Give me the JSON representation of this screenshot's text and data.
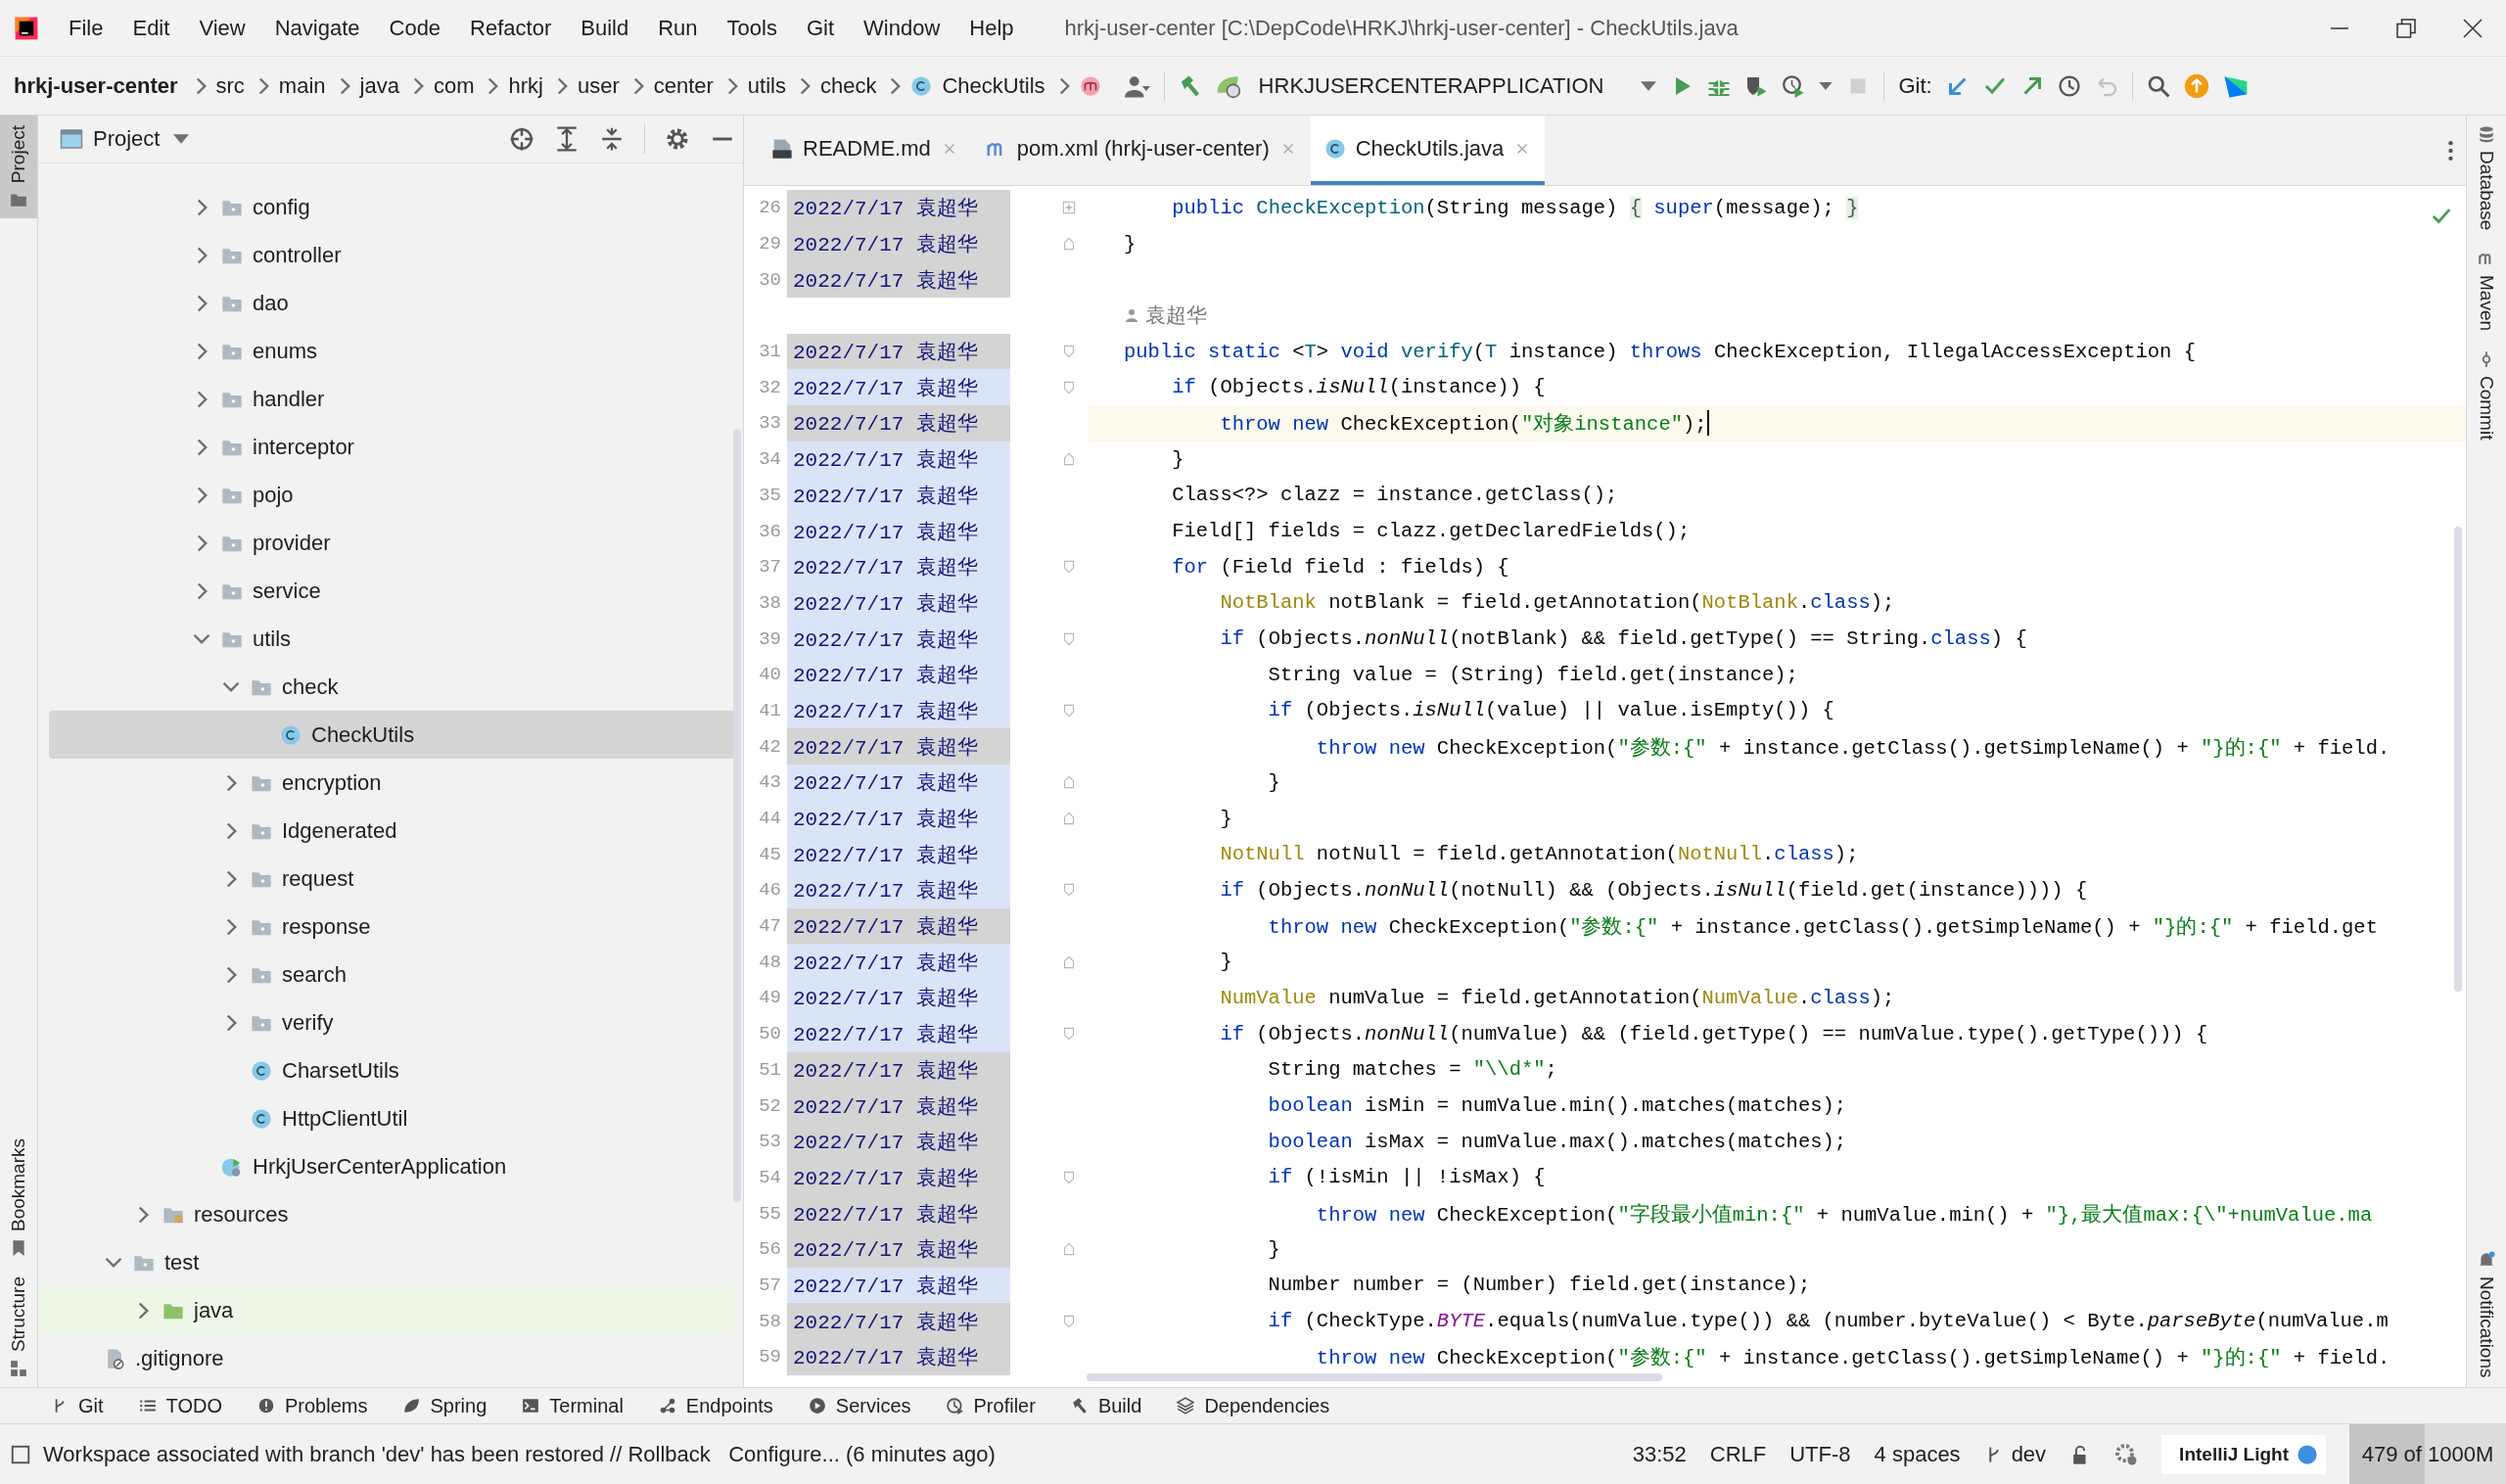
{
  "menu_bar": {
    "items": [
      {
        "label": "File"
      },
      {
        "label": "Edit"
      },
      {
        "label": "View"
      },
      {
        "label": "Navigate"
      },
      {
        "label": "Code"
      },
      {
        "label": "Refactor"
      },
      {
        "label": "Build"
      },
      {
        "label": "Run"
      },
      {
        "label": "Tools"
      },
      {
        "label": "Git"
      },
      {
        "label": "Window"
      },
      {
        "label": "Help"
      }
    ],
    "title": "hrkj-user-center [C:\\DepCode\\HRKJ\\hrkj-user-center] - CheckUtils.java"
  },
  "navigation_bar": {
    "project": "hrkj-user-center",
    "path": [
      "src",
      "main",
      "java",
      "com",
      "hrkj",
      "user",
      "center",
      "utils",
      "check"
    ],
    "file": "CheckUtils",
    "run_configuration": "HRKJUSERCENTERAPPLICATION",
    "git_label": "Git:"
  },
  "left_stripe": [
    {
      "label": "Project",
      "kind": "project",
      "selected": true
    },
    {
      "label": "Bookmarks",
      "kind": "bookmarks",
      "selected": false
    },
    {
      "label": "Structure",
      "kind": "structure",
      "selected": false
    }
  ],
  "project_panel": {
    "title": "Project",
    "tree": [
      {
        "children": [
          {
            "children": [
              {
                "children": [
                  {
                    "children": [
                      {
                        "label": "config",
                        "kind": "folder",
                        "expanded": false,
                        "selected": false
                      },
                      {
                        "label": "controller",
                        "kind": "folder",
                        "expanded": false,
                        "selected": false
                      },
                      {
                        "label": "dao",
                        "kind": "folder",
                        "expanded": false,
                        "selected": false
                      },
                      {
                        "label": "enums",
                        "kind": "folder",
                        "expanded": false,
                        "selected": false
                      },
                      {
                        "label": "handler",
                        "kind": "folder",
                        "expanded": false,
                        "selected": false
                      },
                      {
                        "label": "interceptor",
                        "kind": "folder",
                        "expanded": false,
                        "selected": false
                      },
                      {
                        "label": "pojo",
                        "kind": "folder",
                        "expanded": false,
                        "selected": false
                      },
                      {
                        "label": "provider",
                        "kind": "folder",
                        "expanded": false,
                        "selected": false
                      },
                      {
                        "label": "service",
                        "kind": "folder",
                        "expanded": false,
                        "selected": false
                      },
                      {
                        "label": "utils",
                        "kind": "folder",
                        "expanded": true,
                        "selected": false,
                        "children": [
                          {
                            "label": "check",
                            "kind": "folder",
                            "expanded": true,
                            "selected": false,
                            "children": [
                              {
                                "label": "CheckUtils",
                                "kind": "class",
                                "selected": true
                              }
                            ]
                          },
                          {
                            "label": "encryption",
                            "kind": "folder",
                            "expanded": false,
                            "selected": false
                          },
                          {
                            "label": "Idgenerated",
                            "kind": "folder",
                            "expanded": false,
                            "selected": false
                          },
                          {
                            "label": "request",
                            "kind": "folder",
                            "expanded": false,
                            "selected": false
                          },
                          {
                            "label": "response",
                            "kind": "folder",
                            "expanded": false,
                            "selected": false
                          },
                          {
                            "label": "search",
                            "kind": "folder",
                            "expanded": false,
                            "selected": false
                          },
                          {
                            "label": "verify",
                            "kind": "folder",
                            "expanded": false,
                            "selected": false
                          },
                          {
                            "label": "CharsetUtils",
                            "kind": "class",
                            "selected": false
                          },
                          {
                            "label": "HttpClientUtil",
                            "kind": "class",
                            "selected": false
                          }
                        ]
                      },
                      {
                        "label": "HrkjUserCenterApplication",
                        "kind": "application",
                        "selected": false
                      }
                    ]
                  }
                ]
              },
              {
                "label": "resources",
                "kind": "resources-folder",
                "expanded": false,
                "selected": false
              }
            ]
          },
          {
            "label": "test",
            "kind": "folder",
            "expanded": true,
            "selected": false,
            "children": [
              {
                "label": "java",
                "kind": "test-folder",
                "expanded": false,
                "selected": false
              }
            ]
          }
        ]
      },
      {
        "label": ".gitignore",
        "kind": "ignore-file",
        "selected": false
      }
    ]
  },
  "editor_tabs": [
    {
      "label": "README.md",
      "kind": "markdown",
      "selected": false
    },
    {
      "label": "pom.xml (hrkj-user-center)",
      "kind": "maven",
      "selected": false
    },
    {
      "label": "CheckUtils.java",
      "kind": "class",
      "selected": true
    }
  ],
  "editor": {
    "lines": [
      {
        "kind": "code",
        "number": "26",
        "date": "2022/7/17",
        "author": "袁超华",
        "color": "#d4d4d4",
        "current": false,
        "fold_marker": {
          "kind": "collapsed"
        },
        "tokens": [
          {
            "kind": "keyword",
            "text": "    public "
          },
          {
            "kind": "declaration",
            "text": "CheckException"
          },
          {
            "kind": "plain",
            "text": "(String message) "
          },
          {
            "kind": "folded",
            "text": "{"
          },
          {
            "kind": "keyword",
            "text": " super"
          },
          {
            "kind": "plain",
            "text": "(message); "
          },
          {
            "kind": "folded",
            "text": "}"
          }
        ]
      },
      {
        "kind": "code",
        "number": "29",
        "date": "2022/7/17",
        "author": "袁超华",
        "color": "#d4d4d4",
        "current": false,
        "fold_marker": {
          "kind": "end"
        },
        "tokens": [
          {
            "kind": "plain",
            "text": "}"
          }
        ]
      },
      {
        "kind": "code",
        "number": "30",
        "date": "2022/7/17",
        "author": "袁超华",
        "color": "#d4d4d4",
        "current": false
      },
      {
        "kind": "author-hint",
        "text": "袁超华"
      },
      {
        "kind": "code",
        "number": "31",
        "date": "2022/7/17",
        "author": "袁超华",
        "color": "#d4d4d4",
        "current": false,
        "fold_marker": {
          "kind": "start"
        },
        "tokens": [
          {
            "kind": "keyword",
            "text": "public static "
          },
          {
            "kind": "plain",
            "text": "<"
          },
          {
            "kind": "declaration",
            "text": "T"
          },
          {
            "kind": "plain",
            "text": "> "
          },
          {
            "kind": "keyword",
            "text": "void "
          },
          {
            "kind": "declaration",
            "text": "verify"
          },
          {
            "kind": "plain",
            "text": "("
          },
          {
            "kind": "declaration",
            "text": "T"
          },
          {
            "kind": "plain",
            "text": " instance) "
          },
          {
            "kind": "keyword",
            "text": "throws "
          },
          {
            "kind": "plain",
            "text": "CheckException, IllegalAccessException {"
          }
        ]
      },
      {
        "kind": "code",
        "number": "32",
        "date": "2022/7/17",
        "author": "袁超华",
        "color": "#dbe4f6",
        "current": false,
        "fold_marker": {
          "kind": "start"
        },
        "tokens": [
          {
            "kind": "keyword",
            "text": "    if "
          },
          {
            "kind": "plain",
            "text": "(Objects."
          },
          {
            "kind": "static-call",
            "text": "isNull"
          },
          {
            "kind": "plain",
            "text": "(instance)) {"
          }
        ]
      },
      {
        "kind": "code",
        "number": "33",
        "date": "2022/7/17",
        "author": "袁超华",
        "color": "#d4d4d4",
        "current": true,
        "tokens": [
          {
            "kind": "keyword",
            "text": "        throw new "
          },
          {
            "kind": "plain",
            "text": "CheckException("
          },
          {
            "kind": "string",
            "text": "\"对象instance\""
          },
          {
            "kind": "plain",
            "text": ");"
          }
        ]
      },
      {
        "kind": "code",
        "number": "34",
        "date": "2022/7/17",
        "author": "袁超华",
        "color": "#dbe4f6",
        "current": false,
        "fold_marker": {
          "kind": "end"
        },
        "tokens": [
          {
            "kind": "plain",
            "text": "    }"
          }
        ]
      },
      {
        "kind": "code",
        "number": "35",
        "date": "2022/7/17",
        "author": "袁超华",
        "color": "#dbe4f6",
        "current": false,
        "tokens": [
          {
            "kind": "plain",
            "text": "    Class<?> clazz = instance.getClass();"
          }
        ]
      },
      {
        "kind": "code",
        "number": "36",
        "date": "2022/7/17",
        "author": "袁超华",
        "color": "#dbe4f6",
        "current": false,
        "tokens": [
          {
            "kind": "plain",
            "text": "    Field[] fields = clazz.getDeclaredFields();"
          }
        ]
      },
      {
        "kind": "code",
        "number": "37",
        "date": "2022/7/17",
        "author": "袁超华",
        "color": "#dbe4f6",
        "current": false,
        "fold_marker": {
          "kind": "start"
        },
        "tokens": [
          {
            "kind": "keyword",
            "text": "    for "
          },
          {
            "kind": "plain",
            "text": "(Field field : fields) {"
          }
        ]
      },
      {
        "kind": "code",
        "number": "38",
        "date": "2022/7/17",
        "author": "袁超华",
        "color": "#dbe4f6",
        "current": false,
        "tokens": [
          {
            "kind": "annotation-type",
            "text": "        NotBlank"
          },
          {
            "kind": "plain",
            "text": " notBlank = field.getAnnotation("
          },
          {
            "kind": "annotation-type",
            "text": "NotBlank"
          },
          {
            "kind": "plain",
            "text": "."
          },
          {
            "kind": "keyword",
            "text": "class"
          },
          {
            "kind": "plain",
            "text": ");"
          }
        ]
      },
      {
        "kind": "code",
        "number": "39",
        "date": "2022/7/17",
        "author": "袁超华",
        "color": "#dbe4f6",
        "current": false,
        "fold_marker": {
          "kind": "start"
        },
        "tokens": [
          {
            "kind": "keyword",
            "text": "        if "
          },
          {
            "kind": "plain",
            "text": "(Objects."
          },
          {
            "kind": "static-call",
            "text": "nonNull"
          },
          {
            "kind": "plain",
            "text": "(notBlank) && field.getType() == String."
          },
          {
            "kind": "keyword",
            "text": "class"
          },
          {
            "kind": "plain",
            "text": ") {"
          }
        ]
      },
      {
        "kind": "code",
        "number": "40",
        "date": "2022/7/17",
        "author": "袁超华",
        "color": "#dbe4f6",
        "current": false,
        "tokens": [
          {
            "kind": "plain",
            "text": "            String value = (String) field.get(instance);"
          }
        ]
      },
      {
        "kind": "code",
        "number": "41",
        "date": "2022/7/17",
        "author": "袁超华",
        "color": "#dbe4f6",
        "current": false,
        "fold_marker": {
          "kind": "start"
        },
        "tokens": [
          {
            "kind": "keyword",
            "text": "            if "
          },
          {
            "kind": "plain",
            "text": "(Objects."
          },
          {
            "kind": "static-call",
            "text": "isNull"
          },
          {
            "kind": "plain",
            "text": "(value) || value.isEmpty()) {"
          }
        ]
      },
      {
        "kind": "code",
        "number": "42",
        "date": "2022/7/17",
        "author": "袁超华",
        "color": "#d4d4d4",
        "current": false,
        "tokens": [
          {
            "kind": "keyword",
            "text": "                throw new "
          },
          {
            "kind": "plain",
            "text": "CheckException("
          },
          {
            "kind": "string",
            "text": "\"参数:{\""
          },
          {
            "kind": "plain",
            "text": " + instance.getClass().getSimpleName() + "
          },
          {
            "kind": "string",
            "text": "\"}的:{\""
          },
          {
            "kind": "plain",
            "text": " + field."
          }
        ]
      },
      {
        "kind": "code",
        "number": "43",
        "date": "2022/7/17",
        "author": "袁超华",
        "color": "#dbe4f6",
        "current": false,
        "fold_marker": {
          "kind": "end"
        },
        "tokens": [
          {
            "kind": "plain",
            "text": "            }"
          }
        ]
      },
      {
        "kind": "code",
        "number": "44",
        "date": "2022/7/17",
        "author": "袁超华",
        "color": "#dbe4f6",
        "current": false,
        "fold_marker": {
          "kind": "end"
        },
        "tokens": [
          {
            "kind": "plain",
            "text": "        }"
          }
        ]
      },
      {
        "kind": "code",
        "number": "45",
        "date": "2022/7/17",
        "author": "袁超华",
        "color": "#dbe4f6",
        "current": false,
        "tokens": [
          {
            "kind": "annotation-type",
            "text": "        NotNull"
          },
          {
            "kind": "plain",
            "text": " notNull = field.getAnnotation("
          },
          {
            "kind": "annotation-type",
            "text": "NotNull"
          },
          {
            "kind": "plain",
            "text": "."
          },
          {
            "kind": "keyword",
            "text": "class"
          },
          {
            "kind": "plain",
            "text": ");"
          }
        ]
      },
      {
        "kind": "code",
        "number": "46",
        "date": "2022/7/17",
        "author": "袁超华",
        "color": "#dbe4f6",
        "current": false,
        "fold_marker": {
          "kind": "start"
        },
        "tokens": [
          {
            "kind": "keyword",
            "text": "        if "
          },
          {
            "kind": "plain",
            "text": "(Objects."
          },
          {
            "kind": "static-call",
            "text": "nonNull"
          },
          {
            "kind": "plain",
            "text": "(notNull) && (Objects."
          },
          {
            "kind": "static-call",
            "text": "isNull"
          },
          {
            "kind": "plain",
            "text": "(field.get(instance)))) {"
          }
        ]
      },
      {
        "kind": "code",
        "number": "47",
        "date": "2022/7/17",
        "author": "袁超华",
        "color": "#d4d4d4",
        "current": false,
        "tokens": [
          {
            "kind": "keyword",
            "text": "            throw new "
          },
          {
            "kind": "plain",
            "text": "CheckException("
          },
          {
            "kind": "string",
            "text": "\"参数:{\""
          },
          {
            "kind": "plain",
            "text": " + instance.getClass().getSimpleName() + "
          },
          {
            "kind": "string",
            "text": "\"}的:{\""
          },
          {
            "kind": "plain",
            "text": " + field.get"
          }
        ]
      },
      {
        "kind": "code",
        "number": "48",
        "date": "2022/7/17",
        "author": "袁超华",
        "color": "#dbe4f6",
        "current": false,
        "fold_marker": {
          "kind": "end"
        },
        "tokens": [
          {
            "kind": "plain",
            "text": "        }"
          }
        ]
      },
      {
        "kind": "code",
        "number": "49",
        "date": "2022/7/17",
        "author": "袁超华",
        "color": "#dbe4f6",
        "current": false,
        "tokens": [
          {
            "kind": "annotation-type",
            "text": "        NumValue"
          },
          {
            "kind": "plain",
            "text": " numValue = field.getAnnotation("
          },
          {
            "kind": "annotation-type",
            "text": "NumValue"
          },
          {
            "kind": "plain",
            "text": "."
          },
          {
            "kind": "keyword",
            "text": "class"
          },
          {
            "kind": "plain",
            "text": ");"
          }
        ]
      },
      {
        "kind": "code",
        "number": "50",
        "date": "2022/7/17",
        "author": "袁超华",
        "color": "#dbe4f6",
        "current": false,
        "fold_marker": {
          "kind": "start"
        },
        "tokens": [
          {
            "kind": "keyword",
            "text": "        if "
          },
          {
            "kind": "plain",
            "text": "(Objects."
          },
          {
            "kind": "static-call",
            "text": "nonNull"
          },
          {
            "kind": "plain",
            "text": "(numValue) && (field.getType() == numValue.type().getType())) {"
          }
        ]
      },
      {
        "kind": "code",
        "number": "51",
        "date": "2022/7/17",
        "author": "袁超华",
        "color": "#d4d4d4",
        "current": false,
        "tokens": [
          {
            "kind": "plain",
            "text": "            String matches = "
          },
          {
            "kind": "string",
            "text": "\"\\\\d*\""
          },
          {
            "kind": "plain",
            "text": ";"
          }
        ]
      },
      {
        "kind": "code",
        "number": "52",
        "date": "2022/7/17",
        "author": "袁超华",
        "color": "#d4d4d4",
        "current": false,
        "tokens": [
          {
            "kind": "keyword",
            "text": "            boolean "
          },
          {
            "kind": "plain",
            "text": "isMin = numValue.min().matches(matches);"
          }
        ]
      },
      {
        "kind": "code",
        "number": "53",
        "date": "2022/7/17",
        "author": "袁超华",
        "color": "#d4d4d4",
        "current": false,
        "tokens": [
          {
            "kind": "keyword",
            "text": "            boolean "
          },
          {
            "kind": "plain",
            "text": "isMax = numValue.max().matches(matches);"
          }
        ]
      },
      {
        "kind": "code",
        "number": "54",
        "date": "2022/7/17",
        "author": "袁超华",
        "color": "#d4d4d4",
        "current": false,
        "fold_marker": {
          "kind": "start"
        },
        "tokens": [
          {
            "kind": "keyword",
            "text": "            if "
          },
          {
            "kind": "plain",
            "text": "(!isMin || !isMax) {"
          }
        ]
      },
      {
        "kind": "code",
        "number": "55",
        "date": "2022/7/17",
        "author": "袁超华",
        "color": "#d4d4d4",
        "current": false,
        "tokens": [
          {
            "kind": "keyword",
            "text": "                throw new "
          },
          {
            "kind": "plain",
            "text": "CheckException("
          },
          {
            "kind": "string",
            "text": "\"字段最小值min:{\""
          },
          {
            "kind": "plain",
            "text": " + numValue.min() + "
          },
          {
            "kind": "string",
            "text": "\"},最大值max:{\\\"+numValue.ma"
          }
        ]
      },
      {
        "kind": "code",
        "number": "56",
        "date": "2022/7/17",
        "author": "袁超华",
        "color": "#d4d4d4",
        "current": false,
        "fold_marker": {
          "kind": "end"
        },
        "tokens": [
          {
            "kind": "plain",
            "text": "            }"
          }
        ]
      },
      {
        "kind": "code",
        "number": "57",
        "date": "2022/7/17",
        "author": "袁超华",
        "color": "#dbe4f6",
        "current": false,
        "tokens": [
          {
            "kind": "plain",
            "text": "            Number number = (Number) field.get(instance);"
          }
        ]
      },
      {
        "kind": "code",
        "number": "58",
        "date": "2022/7/17",
        "author": "袁超华",
        "color": "#d4d4d4",
        "current": false,
        "fold_marker": {
          "kind": "start"
        },
        "tokens": [
          {
            "kind": "keyword",
            "text": "            if "
          },
          {
            "kind": "plain",
            "text": "(CheckType."
          },
          {
            "kind": "constant",
            "text": "BYTE"
          },
          {
            "kind": "plain",
            "text": ".equals(numValue.type()) && (number.byteValue() < Byte."
          },
          {
            "kind": "static-call",
            "text": "parseByte"
          },
          {
            "kind": "plain",
            "text": "(numValue.m"
          }
        ]
      },
      {
        "kind": "code",
        "number": "59",
        "date": "2022/7/17",
        "author": "袁超华",
        "color": "#d4d4d4",
        "current": false,
        "tokens": [
          {
            "kind": "keyword",
            "text": "                throw new "
          },
          {
            "kind": "plain",
            "text": "CheckException("
          },
          {
            "kind": "string",
            "text": "\"参数:{\""
          },
          {
            "kind": "plain",
            "text": " + instance.getClass().getSimpleName() + "
          },
          {
            "kind": "string",
            "text": "\"}的:{\""
          },
          {
            "kind": "plain",
            "text": " + field."
          }
        ]
      }
    ]
  },
  "right_stripe": [
    {
      "label": "Database",
      "kind": "database"
    },
    {
      "label": "Maven",
      "kind": "maven"
    },
    {
      "label": "Commit",
      "kind": "commit"
    },
    {
      "label": "Notifications",
      "kind": "notifications"
    }
  ],
  "tool_tabs": [
    {
      "label": "Git",
      "kind": "git"
    },
    {
      "label": "TODO",
      "kind": "todo"
    },
    {
      "label": "Problems",
      "kind": "problems"
    },
    {
      "label": "Spring",
      "kind": "spring"
    },
    {
      "label": "Terminal",
      "kind": "terminal"
    },
    {
      "label": "Endpoints",
      "kind": "endpoints"
    },
    {
      "label": "Services",
      "kind": "services"
    },
    {
      "label": "Profiler",
      "kind": "profiler"
    },
    {
      "label": "Build",
      "kind": "build"
    },
    {
      "label": "Dependencies",
      "kind": "dependencies"
    }
  ],
  "status_bar": {
    "message": "Workspace associated with branch 'dev' has been restored // Rollback   Configure... (6 minutes ago)",
    "position": "33:52",
    "line_separator": "CRLF",
    "encoding": "UTF-8",
    "indent": "4 spaces",
    "branch": "dev",
    "theme": "IntelliJ Light",
    "memory": {
      "text": "479 of 1000M",
      "level": 0.48
    }
  }
}
